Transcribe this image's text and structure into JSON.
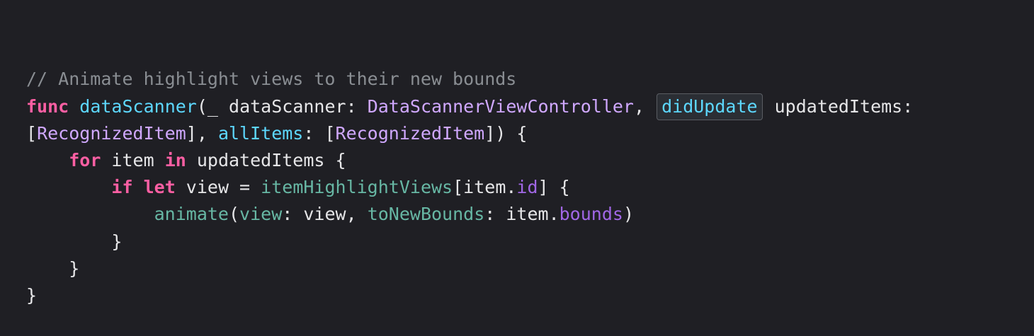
{
  "code": {
    "lines": [
      [
        {
          "t": "// Animate highlight views to their new bounds",
          "k": "comment"
        }
      ],
      [
        {
          "t": "func",
          "k": "keyword"
        },
        {
          "t": " ",
          "k": "plain"
        },
        {
          "t": "dataScanner",
          "k": "decl"
        },
        {
          "t": "(_ dataScanner: ",
          "k": "plain"
        },
        {
          "t": "DataScannerViewController",
          "k": "type"
        },
        {
          "t": ", ",
          "k": "plain"
        },
        {
          "t": "didUpdate",
          "k": "highlight"
        },
        {
          "t": " updatedItems:",
          "k": "plain"
        }
      ],
      [
        {
          "t": "[",
          "k": "plain"
        },
        {
          "t": "RecognizedItem",
          "k": "type"
        },
        {
          "t": "], ",
          "k": "plain"
        },
        {
          "t": "allItems",
          "k": "decl"
        },
        {
          "t": ": [",
          "k": "plain"
        },
        {
          "t": "RecognizedItem",
          "k": "type"
        },
        {
          "t": "]) {",
          "k": "plain"
        }
      ],
      [
        {
          "t": "    ",
          "k": "plain"
        },
        {
          "t": "for",
          "k": "keyword"
        },
        {
          "t": " item ",
          "k": "plain"
        },
        {
          "t": "in",
          "k": "keyword"
        },
        {
          "t": " updatedItems {",
          "k": "plain"
        }
      ],
      [
        {
          "t": "        ",
          "k": "plain"
        },
        {
          "t": "if",
          "k": "keyword"
        },
        {
          "t": " ",
          "k": "plain"
        },
        {
          "t": "let",
          "k": "keyword"
        },
        {
          "t": " view = ",
          "k": "plain"
        },
        {
          "t": "itemHighlightViews",
          "k": "func"
        },
        {
          "t": "[item.",
          "k": "plain"
        },
        {
          "t": "id",
          "k": "prop"
        },
        {
          "t": "] {",
          "k": "plain"
        }
      ],
      [
        {
          "t": "            ",
          "k": "plain"
        },
        {
          "t": "animate",
          "k": "func"
        },
        {
          "t": "(",
          "k": "plain"
        },
        {
          "t": "view",
          "k": "param"
        },
        {
          "t": ": view, ",
          "k": "plain"
        },
        {
          "t": "toNewBounds",
          "k": "param"
        },
        {
          "t": ": item.",
          "k": "plain"
        },
        {
          "t": "bounds",
          "k": "prop"
        },
        {
          "t": ")",
          "k": "plain"
        }
      ],
      [
        {
          "t": "        }",
          "k": "plain"
        }
      ],
      [
        {
          "t": "    }",
          "k": "plain"
        }
      ],
      [
        {
          "t": "}",
          "k": "plain"
        }
      ]
    ]
  },
  "colors": {
    "background": "#1f1f24",
    "comment": "#8a8e93",
    "keyword": "#fc5fa3",
    "declaration": "#5dd8ff",
    "type": "#d0a8ff",
    "function": "#67b7a4",
    "property": "#a167e6",
    "plain": "#e6e6e8"
  }
}
